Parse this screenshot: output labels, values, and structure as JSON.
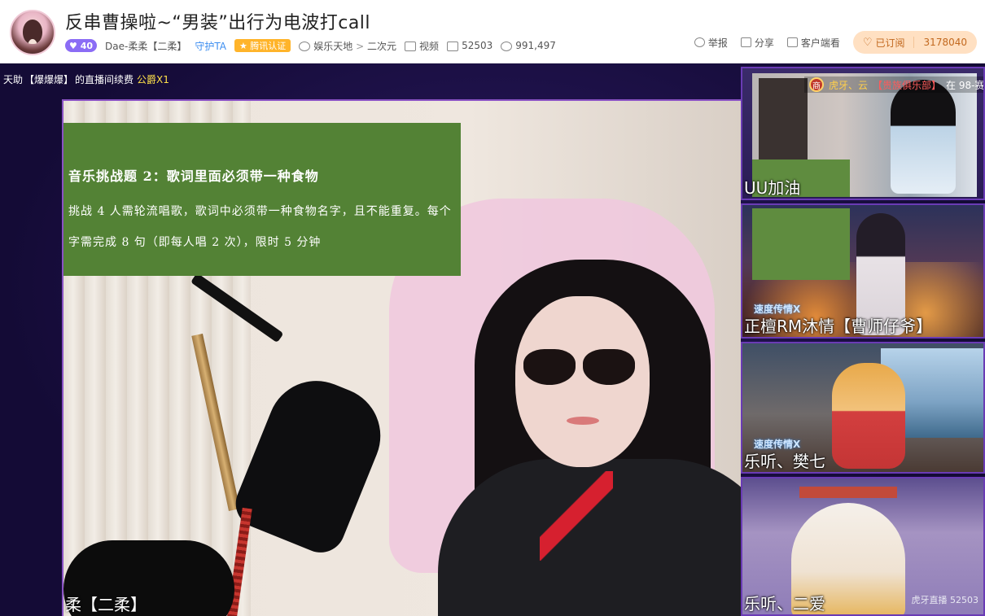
{
  "header": {
    "title": "反串曹操啦~“男装”出行为电波打call",
    "level": "40",
    "streamer": "Dae-柔柔【二柔】",
    "guard": "守护TA",
    "badge": "腾讯认证",
    "category_parent": "娱乐天地",
    "category_sep": ">",
    "category_child": "二次元",
    "video_label": "视频",
    "room_id": "52503",
    "viewers": "991,497",
    "actions": {
      "report": "举报",
      "share": "分享",
      "client": "客户端看"
    },
    "follow": {
      "label": "已订阅",
      "count": "3178040"
    }
  },
  "ticker": {
    "prefix": "天助",
    "highlight": "【爆爆爆】",
    "middle": "的直播间续费",
    "suffix": "公爵X1"
  },
  "main_video": {
    "notice_title": "音乐挑战题 2：歌词里面必须带一种食物",
    "notice_body": "挑战 4 人需轮流唱歌，歌词中必须带一种食物名字，且不能重复。每个字需完成 8 句（即每人唱 2 次），限时 5 分钟",
    "name_caption": "柔【二柔】"
  },
  "side_tiles": [
    {
      "caption": "UU加油",
      "banner_tag": "商",
      "banner_user": "虎牙、云",
      "banner_group": "【贵族俱乐部】",
      "banner_text": "在 98-赛"
    },
    {
      "caption": "正檀RM沐情【曹师仔爷】",
      "corner": "速度传情X"
    },
    {
      "caption": "乐听、樊七",
      "corner": "速度传情X"
    },
    {
      "caption": "乐听、二爱",
      "watermark": "虎牙直播 52503"
    }
  ]
}
